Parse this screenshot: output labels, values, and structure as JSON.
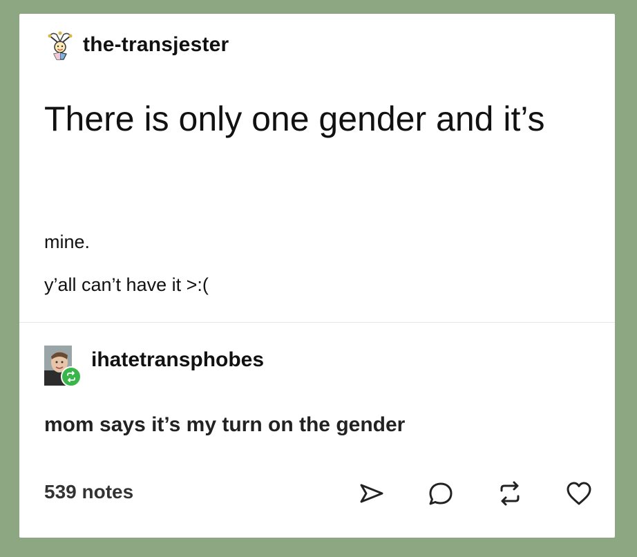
{
  "op": {
    "username": "the-transjester",
    "avatar_icon": "jester-icon",
    "title": "There is only one gender and it’s",
    "lines": [
      "mine.",
      "y’all can’t have it >:("
    ]
  },
  "reblog": {
    "username": "ihatetransphobes",
    "avatar_icon": "user-photo-avatar",
    "badge_icon": "reblog-icon",
    "badge_color": "#39b54a",
    "text": "mom says it’s my turn on the gender"
  },
  "footer": {
    "notes": "539 notes",
    "actions": [
      {
        "name": "share",
        "icon": "share-icon"
      },
      {
        "name": "reply",
        "icon": "reply-icon"
      },
      {
        "name": "reblog",
        "icon": "reblog-icon"
      },
      {
        "name": "like",
        "icon": "heart-icon"
      }
    ]
  },
  "colors": {
    "frame": "#8ea783",
    "card": "#ffffff",
    "text": "#111111",
    "badge": "#39b54a"
  }
}
